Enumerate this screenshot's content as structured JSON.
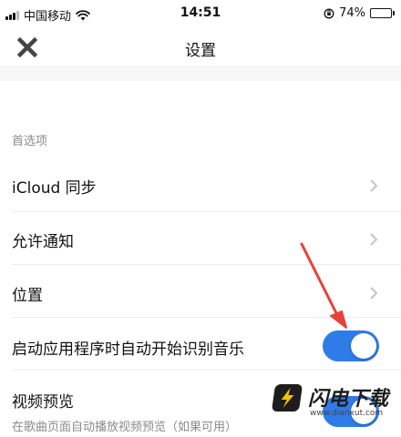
{
  "status_bar": {
    "carrier": "中国移动",
    "time": "14:51",
    "battery_text": "74%",
    "battery_level": 0.74
  },
  "nav": {
    "title": "设置"
  },
  "section": {
    "header": "首选项"
  },
  "rows": [
    {
      "label": "iCloud 同步",
      "control": "chevron"
    },
    {
      "label": "允许通知",
      "control": "chevron"
    },
    {
      "label": "位置",
      "control": "chevron"
    },
    {
      "label": "启动应用程序时自动开始识别音乐",
      "control": "toggle",
      "on": true
    },
    {
      "label": "视频预览",
      "control": "toggle",
      "on": true,
      "sub": "在歌曲页面自动播放视频预览（如果可用）"
    }
  ],
  "watermark": {
    "name": "闪电下载",
    "url": "www.dianxut.com"
  },
  "colors": {
    "toggle_on": "#2f7ce8",
    "annotation_arrow": "#e8403a"
  }
}
